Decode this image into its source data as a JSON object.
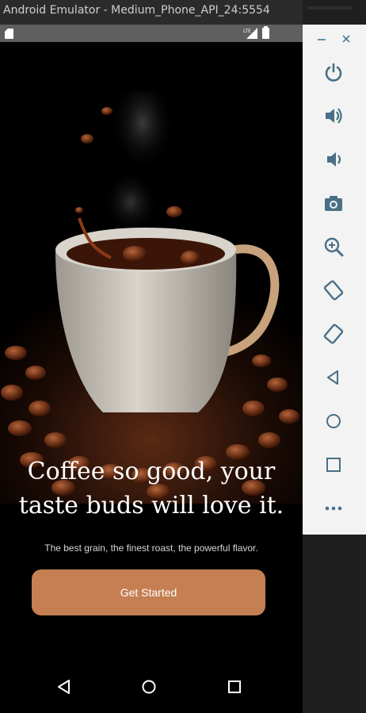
{
  "window": {
    "title": "Android Emulator - Medium_Phone_API_24:5554"
  },
  "status_bar": {
    "network_label": "LTE"
  },
  "onboarding": {
    "headline_line1": "Coffee so good, your",
    "headline_line2": "taste buds will love it.",
    "subtitle": "The best grain, the finest roast, the powerful flavor.",
    "cta_label": "Get Started"
  },
  "nav_bar": {
    "buttons": [
      "back",
      "home",
      "recents"
    ]
  },
  "toolbar": {
    "items": [
      "power",
      "volume-up",
      "volume-down",
      "screenshot",
      "zoom",
      "rotate-left",
      "rotate-right",
      "back",
      "home",
      "overview",
      "more"
    ]
  },
  "colors": {
    "accent": "#c57f52",
    "toolbar_icon": "#4a6f86",
    "screen_bg": "#000000"
  }
}
